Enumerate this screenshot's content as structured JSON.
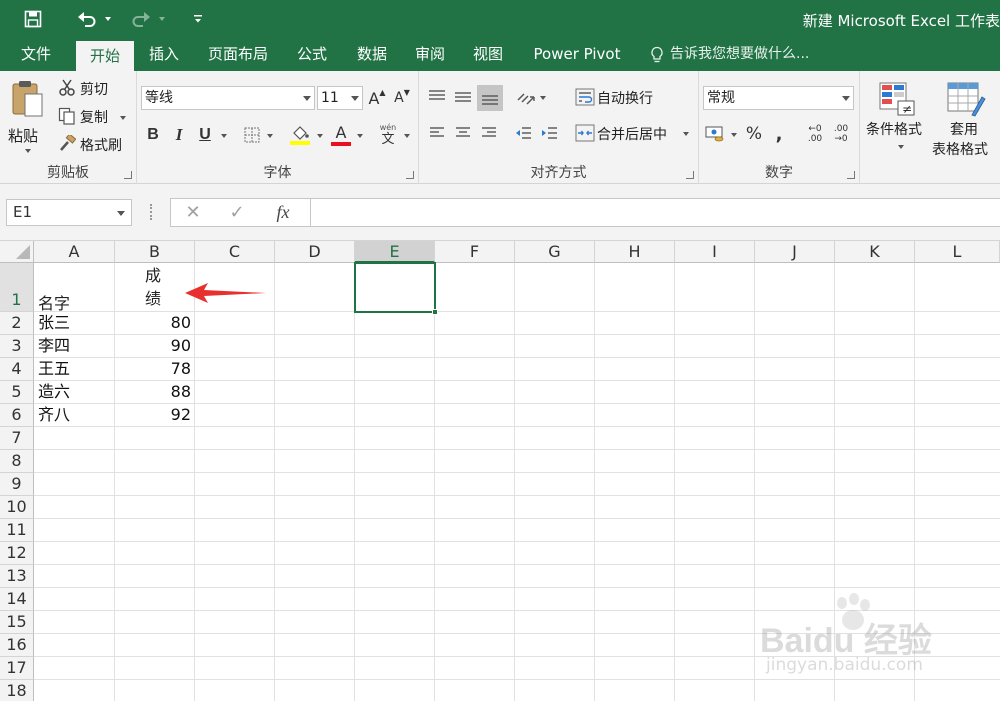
{
  "app": {
    "title": "新建 Microsoft Excel 工作表"
  },
  "qat": {
    "save_icon": "save-icon",
    "undo_icon": "undo-icon",
    "redo_icon": "redo-icon",
    "customize_icon": "customize-qat-icon"
  },
  "tabs": [
    {
      "label": "文件"
    },
    {
      "label": "开始"
    },
    {
      "label": "插入"
    },
    {
      "label": "页面布局"
    },
    {
      "label": "公式"
    },
    {
      "label": "数据"
    },
    {
      "label": "审阅"
    },
    {
      "label": "视图"
    },
    {
      "label": "Power Pivot"
    }
  ],
  "tell_me": "告诉我您想要做什么...",
  "ribbon": {
    "clipboard": {
      "paste": "粘贴",
      "cut": "剪切",
      "copy": "复制",
      "format_painter": "格式刷",
      "group_label": "剪贴板"
    },
    "font": {
      "font_name": "等线",
      "font_size": "11",
      "group_label": "字体",
      "bold": "B",
      "italic": "I",
      "underline": "U",
      "grow": "A",
      "shrink": "A",
      "font_color": "A",
      "phonetic_top": "wén",
      "phonetic_bottom": "文"
    },
    "alignment": {
      "wrap_text": "自动换行",
      "merge_center": "合并后居中",
      "group_label": "对齐方式"
    },
    "number": {
      "format": "常规",
      "percent": "%",
      "comma": ",",
      "inc_decimal_top": "←0",
      "inc_decimal_bottom": ".00",
      "dec_decimal_top": ".00",
      "dec_decimal_bottom": "→0",
      "group_label": "数字"
    },
    "styles": {
      "conditional_format": "条件格式",
      "table_format_line1": "套用",
      "table_format_line2": "表格格式"
    }
  },
  "formula_bar": {
    "name_box": "E1",
    "cancel": "✕",
    "enter": "✓",
    "fx": "fx",
    "content": ""
  },
  "sheet": {
    "columns": [
      "A",
      "B",
      "C",
      "D",
      "E",
      "F",
      "G",
      "H",
      "I",
      "J",
      "K",
      "L"
    ],
    "rows": [
      "1",
      "2",
      "3",
      "4",
      "5",
      "6",
      "7",
      "8",
      "9",
      "10",
      "11",
      "12",
      "13",
      "14",
      "15",
      "16",
      "17",
      "18"
    ],
    "selected_cell": "E1",
    "A1": "名字",
    "B1_line1": "成",
    "B1_line2": "绩",
    "data_rows": [
      {
        "name": "张三",
        "score": "80"
      },
      {
        "name": "李四",
        "score": "90"
      },
      {
        "name": "王五",
        "score": "78"
      },
      {
        "name": "造六",
        "score": "88"
      },
      {
        "name": "齐八",
        "score": "92"
      }
    ]
  },
  "annotation": {
    "arrow_color": "#e8312f"
  },
  "watermark": {
    "brand": "Baidu 经验",
    "url": "jingyan.baidu.com"
  },
  "colors": {
    "accent": "#217346"
  }
}
